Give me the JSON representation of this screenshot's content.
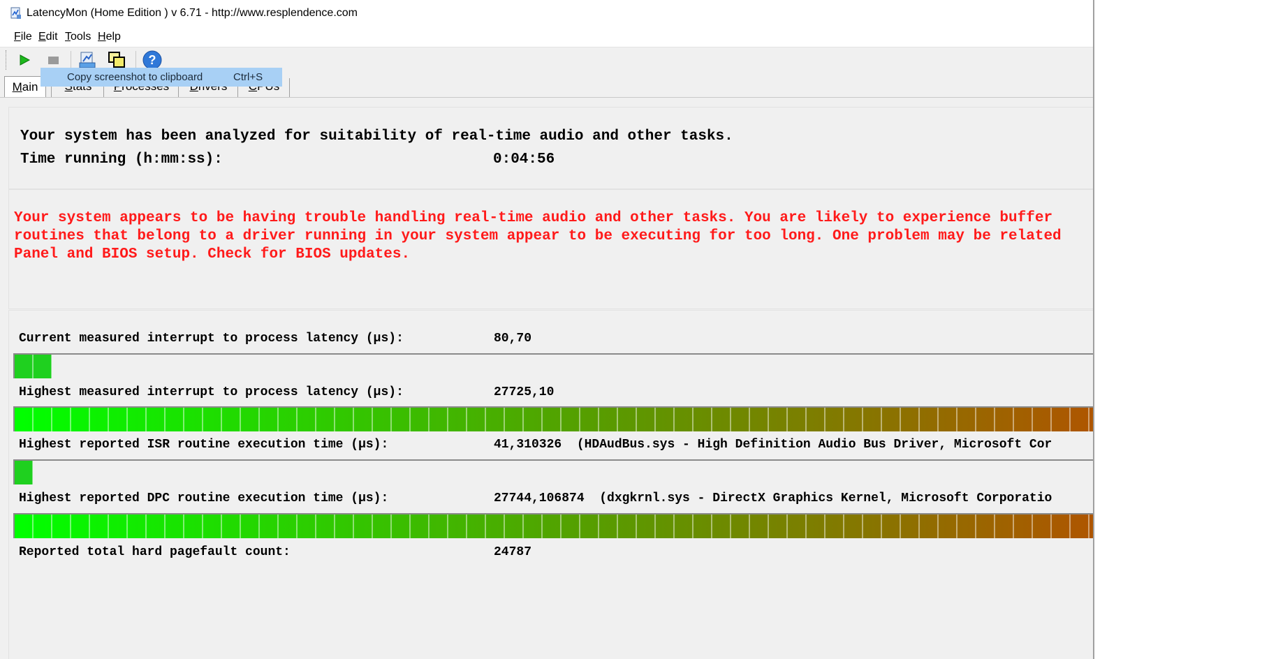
{
  "window": {
    "title": "LatencyMon  (Home Edition )  v 6.71 - http://www.resplendence.com"
  },
  "menu": {
    "items": [
      {
        "acc": "F",
        "rest": "ile"
      },
      {
        "acc": "E",
        "rest": "dit"
      },
      {
        "acc": "T",
        "rest": "ools"
      },
      {
        "acc": "H",
        "rest": "elp"
      }
    ]
  },
  "toolbar": {
    "icons": [
      "play-icon",
      "stop-icon",
      "drivers-icon",
      "copy-windows-icon",
      "help-icon"
    ],
    "tooltip": {
      "label": "Copy screenshot to clipboard",
      "shortcut": "Ctrl+S"
    }
  },
  "tabs": [
    {
      "acc": "M",
      "rest": "ain",
      "active": true
    },
    {
      "acc": "S",
      "rest": "tats",
      "active": false
    },
    {
      "acc": "P",
      "rest": "rocesses",
      "active": false
    },
    {
      "acc": "D",
      "rest": "rivers",
      "active": false
    },
    {
      "acc": "C",
      "rest": "PUs",
      "active": false
    }
  ],
  "summary": {
    "analyzed_text": "Your system has been analyzed for suitability of real-time audio and other tasks.",
    "time_label": "Time running (h:mm:ss):",
    "time_value": "0:04:56"
  },
  "warning": {
    "lines": [
      "Your system appears to be having trouble handling real-time audio and other tasks. You are likely to experience buffer",
      "routines that belong to a driver running in your system appear to be executing for too long. One problem may be related",
      "Panel and BIOS setup. Check for BIOS updates."
    ],
    "color": "#ff1a1a"
  },
  "metrics": [
    {
      "label": "Current measured interrupt to process latency (µs):",
      "value": "80,70",
      "extra": "",
      "bar_fraction": 0.034
    },
    {
      "label": "Highest measured interrupt to process latency (µs):",
      "value": "27725,10",
      "extra": "",
      "bar_fraction": 1.0
    },
    {
      "label": "Highest reported ISR routine execution time (µs):",
      "value": "41,310326",
      "extra": "(HDAudBus.sys - High Definition Audio Bus Driver, Microsoft Cor",
      "bar_fraction": 0.017
    },
    {
      "label": "Highest reported DPC routine execution time (µs):",
      "value": "27744,106874",
      "extra": "(dxgkrnl.sys - DirectX Graphics Kernel, Microsoft Corporatio",
      "bar_fraction": 1.0
    },
    {
      "label": "Reported total hard pagefault count:",
      "value": "24787",
      "extra": "",
      "bar_fraction": null
    }
  ],
  "colors": {
    "bar_start": "#00ff00",
    "bar_mid": "#5a9a00",
    "bar_end": "#b05400"
  }
}
